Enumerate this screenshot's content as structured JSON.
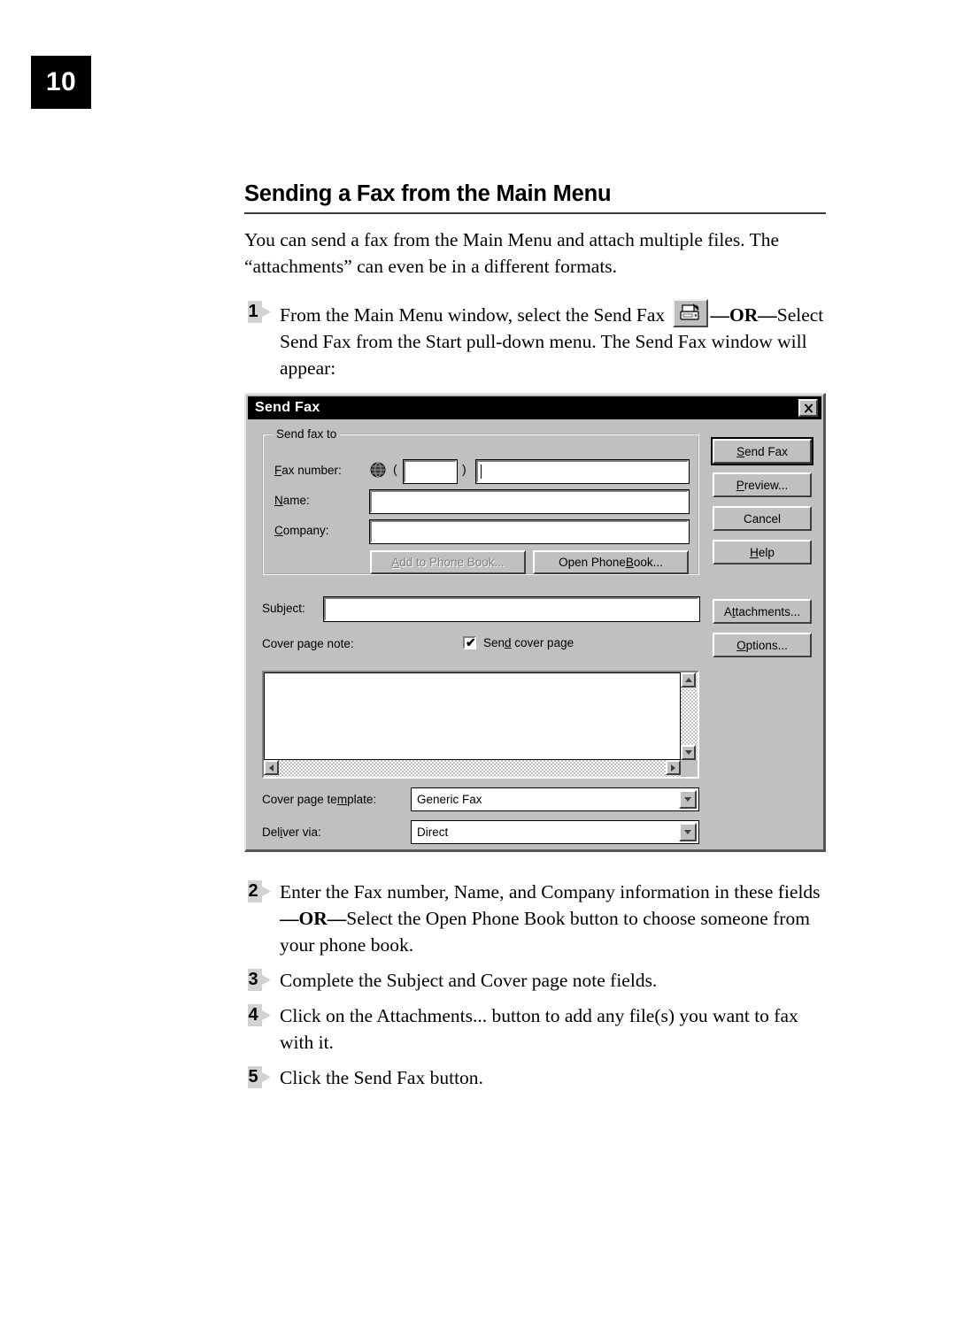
{
  "page": {
    "number": "10"
  },
  "article": {
    "title": "Sending a Fax from the Main Menu",
    "intro": "You can send a fax from the Main Menu and attach multiple files. The “attachments” can even be in a different formats.",
    "steps": [
      {
        "number": "1",
        "text_before_icon": "From the Main Menu window, select the Send Fax ",
        "icon": "fax-machine-icon",
        "text_or": "—OR—",
        "text_after_icon": "Select Send Fax from the Start pull-down menu.  The Send Fax window will appear:"
      },
      {
        "number": "2",
        "text_before_or": "Enter the Fax number, Name, and Company information in these fields ",
        "text_or": "—OR—",
        "text_after_or": "Select the Open Phone Book button to choose someone from your phone book."
      },
      {
        "number": "3",
        "text": "Complete the Subject and Cover page note fields."
      },
      {
        "number": "4",
        "text": "Click on the Attachments... button to add any file(s) you want to fax with it."
      },
      {
        "number": "5",
        "text": "Click the Send Fax button."
      }
    ]
  },
  "dialog": {
    "title": "Send Fax",
    "close_label": "✕",
    "group": {
      "legend": "Send fax to",
      "fax_number": {
        "label_pre": "F",
        "label_acc": "",
        "label": "Fax number:",
        "accel": "F",
        "globe_icon": "globe-icon",
        "open_paren": "(",
        "close_paren": ")",
        "area_code_value": "",
        "number_value": ""
      },
      "name": {
        "label": "Name:",
        "accel": "N",
        "value": ""
      },
      "company": {
        "label": "Company:",
        "accel": "C",
        "value": ""
      },
      "add_phone_book": {
        "label": "Add to Phone Book...",
        "accel": "A",
        "enabled": false
      },
      "open_phone_book": {
        "label": "Open Phone Book...",
        "accel": "B",
        "enabled": true
      }
    },
    "subject": {
      "label": "Subject:",
      "accel": "j",
      "value": ""
    },
    "cover_page_note": {
      "label": "Cover page note:",
      "accel": "g",
      "value": ""
    },
    "send_cover_page": {
      "label": "Send cover page",
      "accel": "d",
      "checked": true,
      "checkmark": "✔"
    },
    "cover_page_template": {
      "label": "Cover page template:",
      "accel": "m",
      "value": "Generic Fax",
      "options": [
        "Generic Fax"
      ]
    },
    "deliver_via": {
      "label": "Deliver via:",
      "accel": "i",
      "value": "Direct",
      "options": [
        "Direct"
      ]
    },
    "buttons": {
      "send_fax": {
        "label": "Send Fax",
        "accel": "S",
        "default": true
      },
      "preview": {
        "label": "Preview...",
        "accel": "P"
      },
      "cancel": {
        "label": "Cancel",
        "accel": ""
      },
      "help": {
        "label": "Help",
        "accel": "H"
      },
      "attachments": {
        "label": "Attachments...",
        "accel": "t"
      },
      "options": {
        "label": "Options...",
        "accel": "O"
      }
    }
  },
  "colors": {
    "dialog_face": "#c0c0c0",
    "titlebar": "#000000",
    "titlebar_text": "#ffffff",
    "field_bg": "#ffffff",
    "disabled_text": "#808080",
    "page_badge_bg": "#000000"
  }
}
